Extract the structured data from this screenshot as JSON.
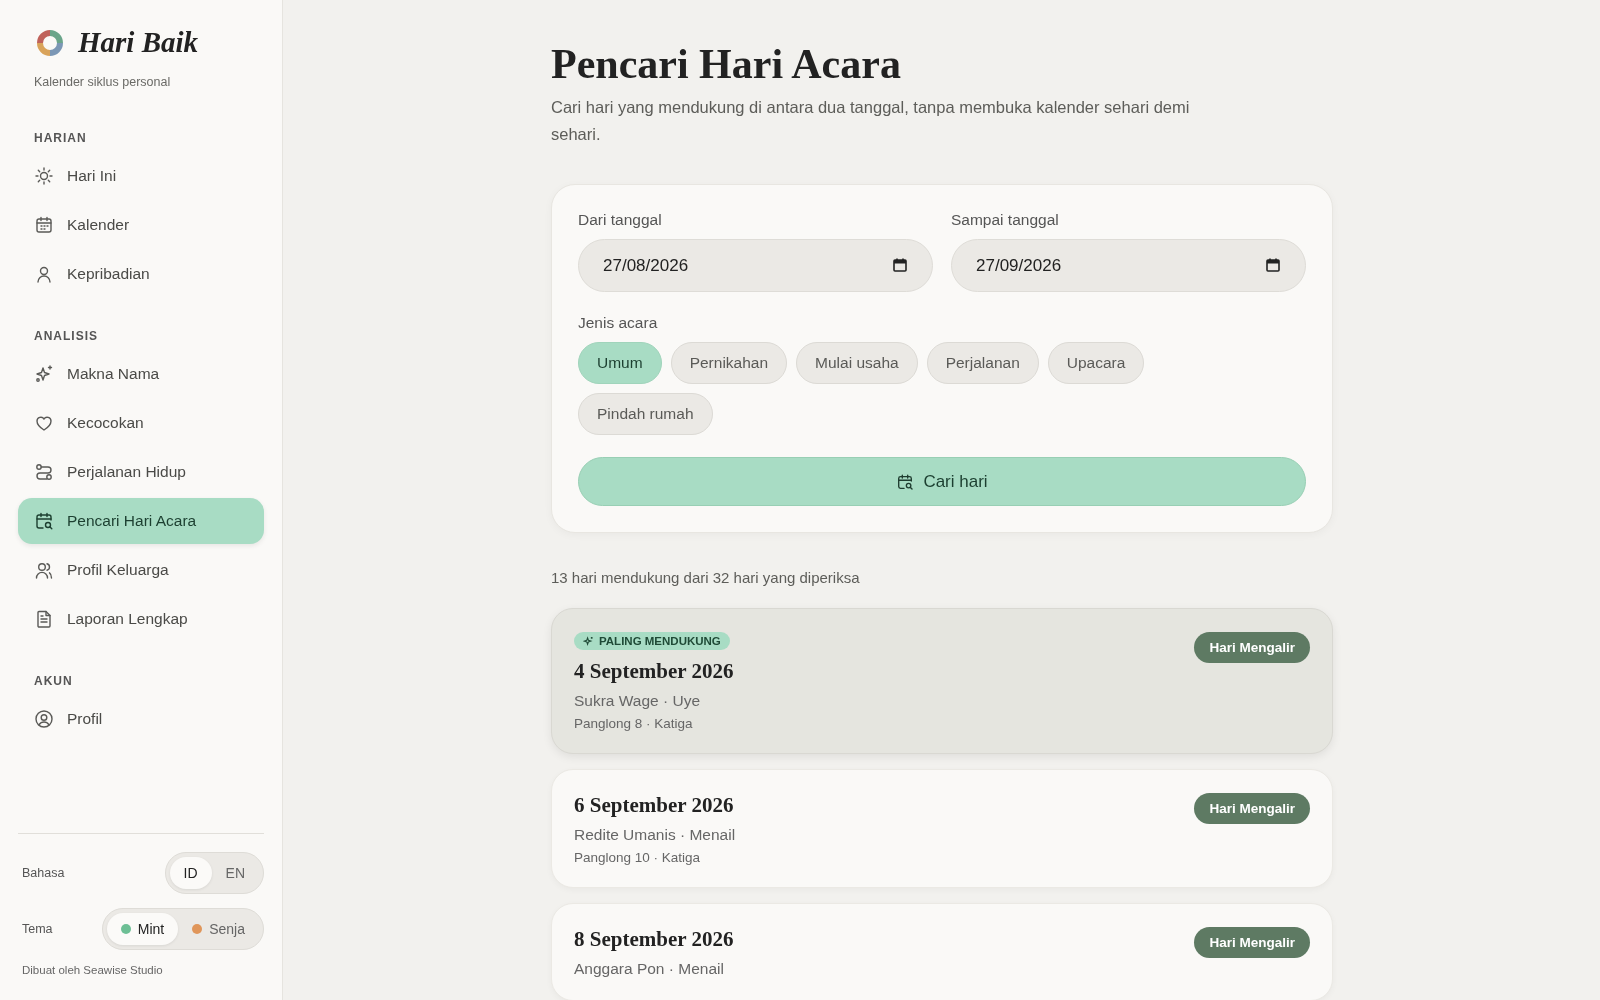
{
  "brand": {
    "name": "Hari Baik",
    "tagline": "Kalender siklus personal"
  },
  "sidebar": {
    "sections": [
      {
        "heading": "HARIAN",
        "items": [
          {
            "label": "Hari Ini",
            "selected": false
          },
          {
            "label": "Kalender",
            "selected": false
          },
          {
            "label": "Kepribadian",
            "selected": false
          }
        ]
      },
      {
        "heading": "ANALISIS",
        "items": [
          {
            "label": "Makna Nama",
            "selected": false
          },
          {
            "label": "Kecocokan",
            "selected": false
          },
          {
            "label": "Perjalanan Hidup",
            "selected": false
          },
          {
            "label": "Pencari Hari Acara",
            "selected": true
          },
          {
            "label": "Profil Keluarga",
            "selected": false
          },
          {
            "label": "Laporan Lengkap",
            "selected": false
          }
        ]
      },
      {
        "heading": "AKUN",
        "items": [
          {
            "label": "Profil",
            "selected": false
          }
        ]
      }
    ]
  },
  "settings": {
    "language": {
      "label": "Bahasa",
      "options": [
        {
          "label": "ID",
          "selected": true
        },
        {
          "label": "EN",
          "selected": false
        }
      ]
    },
    "theme": {
      "label": "Tema",
      "options": [
        {
          "label": "Mint",
          "color": "#6dbf95",
          "selected": true
        },
        {
          "label": "Senja",
          "color": "#e0965a",
          "selected": false
        }
      ]
    },
    "credit": "Dibuat oleh Seawise Studio"
  },
  "page": {
    "title": "Pencari Hari Acara",
    "subtitle": "Cari hari yang mendukung di antara dua tanggal, tanpa membuka kalender sehari demi sehari."
  },
  "form": {
    "from": {
      "label": "Dari tanggal",
      "value": "27/08/2026"
    },
    "to": {
      "label": "Sampai tanggal",
      "value": "27/09/2026"
    },
    "event_label": "Jenis acara",
    "event_types": [
      {
        "label": "Umum",
        "selected": true
      },
      {
        "label": "Pernikahan",
        "selected": false
      },
      {
        "label": "Mulai usaha",
        "selected": false
      },
      {
        "label": "Perjalanan",
        "selected": false
      },
      {
        "label": "Upacara",
        "selected": false
      },
      {
        "label": "Pindah rumah",
        "selected": false
      }
    ],
    "submit": "Cari hari"
  },
  "summary": "13 hari mendukung dari 32 hari yang diperiksa",
  "results": [
    {
      "highlighted": true,
      "badge": "PALING MENDUKUNG",
      "date": "4 September 2026",
      "line1": "Sukra Wage · Uye",
      "line2": "Panglong 8 · Katiga",
      "tag": "Hari Mengalir"
    },
    {
      "highlighted": false,
      "date": "6 September 2026",
      "line1": "Redite Umanis · Menail",
      "line2": "Panglong 10 · Katiga",
      "tag": "Hari Mengalir"
    },
    {
      "highlighted": false,
      "date": "8 September 2026",
      "line1": "Anggara Pon · Menail",
      "tag": "Hari Mengalir"
    }
  ]
}
